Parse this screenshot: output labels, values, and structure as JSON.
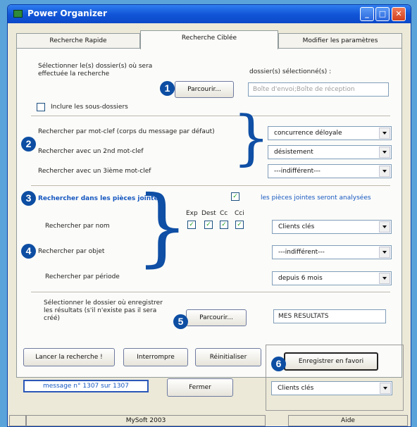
{
  "window": {
    "title": "Power Organizer"
  },
  "title_buttons": {
    "minimize": "_",
    "maximize": "□",
    "close": "✕"
  },
  "tabs": [
    {
      "label": "Recherche Rapide"
    },
    {
      "label": "Recherche Ciblée"
    },
    {
      "label": "Modifier les paramètres"
    }
  ],
  "folders": {
    "select_text": "Sélectionner le(s) dossier(s) où sera effectuée la recherche",
    "selected_label": "dossier(s) sélectionné(s) :",
    "browse_label": "Parcourir...",
    "selected_value": "Boîte d'envoi;Boîte de réception",
    "subfolders_label": "Inclure les sous-dossiers"
  },
  "keywords": {
    "kw1_label": "Rechercher par mot-clef (corps du message par défaut)",
    "kw2_label": "Rechercher avec un 2nd mot-clef",
    "kw3_label": "Rechercher avec un 3ième mot-clef",
    "kw1_value": "concurrence déloyale",
    "kw2_value": "désistement",
    "kw3_value": "---indifférent---"
  },
  "attachments": {
    "label": "Rechercher dans les pièces jointes",
    "checkbox_mark": "✓",
    "note": "les pièces jointes seront analysées"
  },
  "name_search": {
    "headers": [
      "Exp",
      "Dest",
      "Cc",
      "Cci"
    ],
    "label": "Rechercher par nom",
    "value": "Clients clés"
  },
  "subject_search": {
    "label": "Rechercher par objet",
    "value": "---indifférent---"
  },
  "period_search": {
    "label": "Rechercher par période",
    "value": "depuis 6 mois"
  },
  "results": {
    "text": "Sélectionner le dossier où enregistrer les résultats (s'il n'existe pas il sera créé)",
    "browse_label": "Parcourir...",
    "folder_value": "MES RESULTATS"
  },
  "actions": {
    "launch": "Lancer la recherche !",
    "interrupt": "Interrompre",
    "reset": "Réinitialiser",
    "save_fav": "Enregistrer en favori",
    "close": "Fermer"
  },
  "status": {
    "message": "message n° 1307 sur 1307"
  },
  "favorite": {
    "value": "Clients clés"
  },
  "statusbar": {
    "left": "",
    "center": "MySoft 2003",
    "right": "Aide"
  },
  "badges": [
    "1",
    "2",
    "3",
    "4",
    "5",
    "6"
  ],
  "colors": {
    "badge": "#0d4ea3",
    "titlebar": "#1256d8",
    "background": "#5aa3da"
  }
}
